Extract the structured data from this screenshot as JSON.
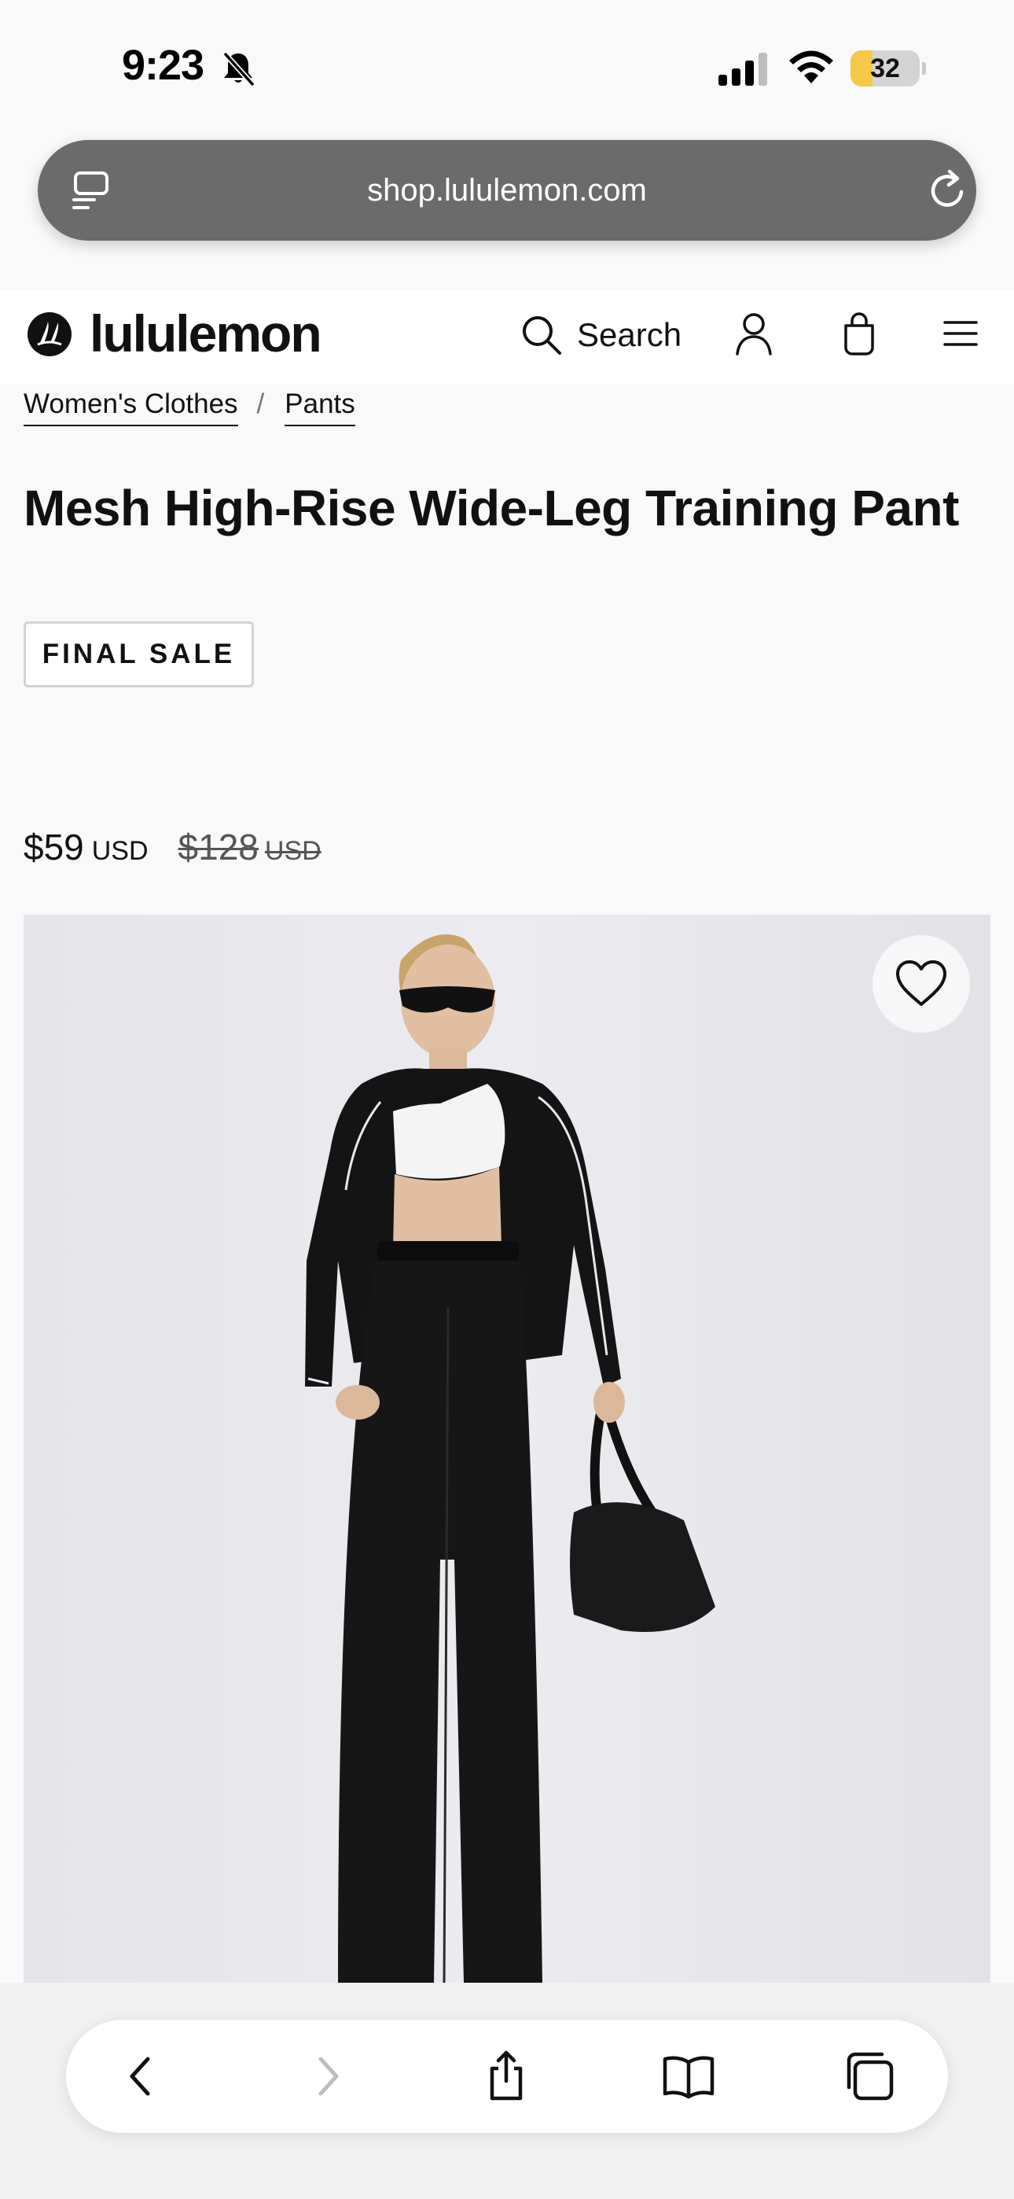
{
  "status_bar": {
    "time": "9:23",
    "battery_level": "32",
    "battery_fraction": 0.32,
    "icons": [
      "bell-slash-icon",
      "cellular-signal-icon",
      "wifi-icon",
      "battery-icon"
    ]
  },
  "browser": {
    "url": "shop.lululemon.com",
    "icons": [
      "reader-mode-icon",
      "reload-icon"
    ]
  },
  "header": {
    "logo_text": "lululemon",
    "search_label": "Search",
    "icons": [
      "logo-mark-icon",
      "search-icon",
      "account-icon",
      "bag-icon",
      "hamburger-menu-icon"
    ]
  },
  "breadcrumb": {
    "items": [
      "Women's Clothes",
      "Pants"
    ],
    "separator": "/"
  },
  "product": {
    "title": "Mesh High-Rise Wide-Leg Training Pant",
    "badge": "FINAL SALE",
    "price": {
      "current": "$59",
      "current_currency": "USD",
      "original": "$128",
      "original_currency": "USD"
    },
    "image": {
      "wishlist_icon": "heart-icon"
    }
  },
  "toolbar": {
    "icons": [
      "back-arrow-icon",
      "forward-arrow-icon",
      "share-icon",
      "bookmarks-icon",
      "tabs-icon"
    ]
  },
  "colors": {
    "background": "#f9f9f9",
    "text": "#111111",
    "url_bar": "#6b6b6b",
    "battery_accent": "#f5c84a",
    "image_background": "#e8e8ec"
  }
}
